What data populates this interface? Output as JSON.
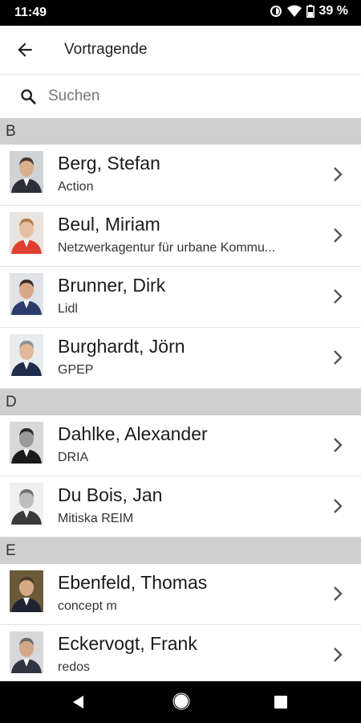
{
  "status": {
    "time": "11:49",
    "battery": "39 %"
  },
  "appbar": {
    "title": "Vortragende"
  },
  "search": {
    "placeholder": "Suchen"
  },
  "sections": [
    {
      "letter": "B",
      "items": [
        {
          "name": "Berg, Stefan",
          "company": "Action",
          "bg": "#cfd3d6",
          "skin": "#d9b08e",
          "hair": "#4a3a2e",
          "shirt": "#2b2f3a"
        },
        {
          "name": "Beul, Miriam",
          "company": "Netzwerkagentur für urbane Kommu...",
          "bg": "#e9e4df",
          "skin": "#e6bfa3",
          "hair": "#b47a43",
          "shirt": "#e0402f"
        },
        {
          "name": "Brunner, Dirk",
          "company": "Lidl",
          "bg": "#dfe2e6",
          "skin": "#d8a887",
          "hair": "#3b2c22",
          "shirt": "#2a3c6b"
        },
        {
          "name": "Burghardt, Jörn",
          "company": "GPEP",
          "bg": "#e8ecef",
          "skin": "#e2b89a",
          "hair": "#8f8f8f",
          "shirt": "#1f2d4a"
        }
      ]
    },
    {
      "letter": "D",
      "items": [
        {
          "name": "Dahlke, Alexander",
          "company": "DRIA",
          "bg": "#d9d9d9",
          "skin": "#9a9a9a",
          "hair": "#2a2a2a",
          "shirt": "#1b1b1b"
        },
        {
          "name": "Du Bois, Jan",
          "company": "Mitiska REIM",
          "bg": "#f0f0f0",
          "skin": "#bdbdbd",
          "hair": "#6e6e6e",
          "shirt": "#3a3a3a"
        }
      ]
    },
    {
      "letter": "E",
      "items": [
        {
          "name": "Ebenfeld, Thomas",
          "company": "concept m",
          "bg": "#6a5a3a",
          "skin": "#d9a985",
          "hair": "#4b3a2b",
          "shirt": "#1f2433"
        },
        {
          "name": "Eckervogt, Frank",
          "company": "redos",
          "bg": "#d6d8da",
          "skin": "#d3a888",
          "hair": "#6b6b6b",
          "shirt": "#2f3440"
        }
      ]
    }
  ]
}
